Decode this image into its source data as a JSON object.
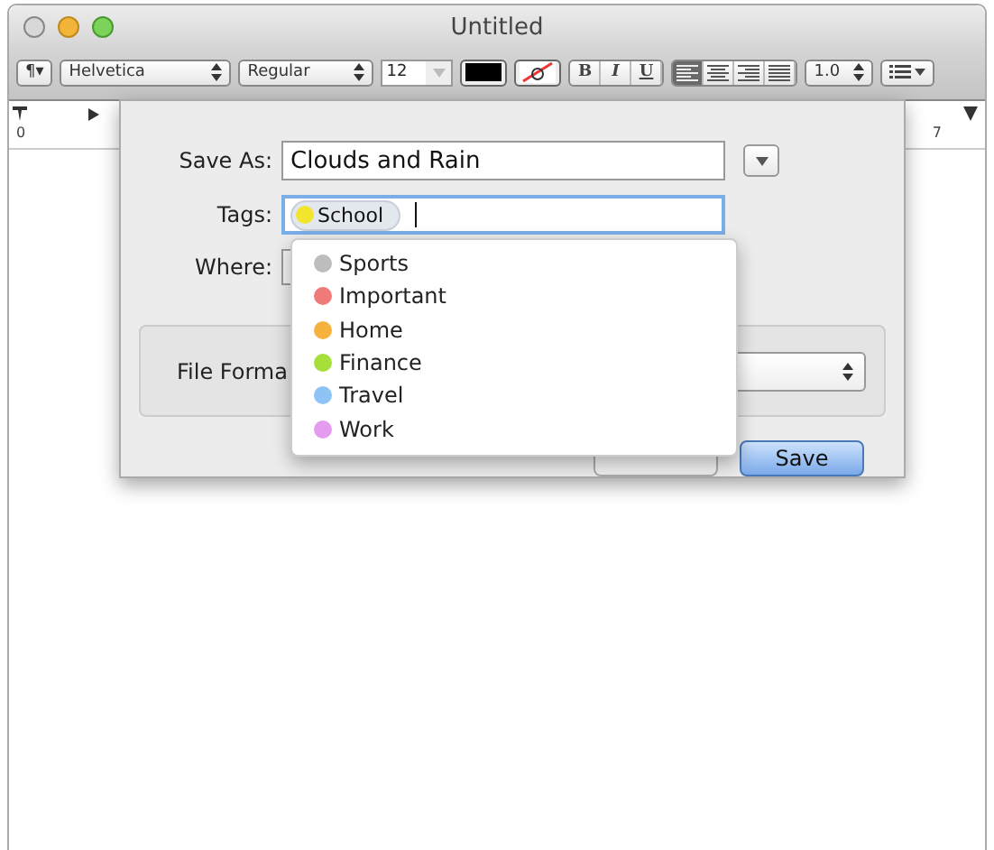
{
  "window": {
    "title": "Untitled"
  },
  "toolbar": {
    "paragraph": "¶▾",
    "font": "Helvetica",
    "style": "Regular",
    "size": "12",
    "font_styles": [
      "B",
      "I",
      "U"
    ],
    "alignment": [
      {
        "selected": true
      },
      {
        "selected": false
      },
      {
        "selected": false
      },
      {
        "selected": false
      }
    ],
    "spacing": "1.0"
  },
  "ruler": {
    "labels": [
      "0",
      "7"
    ]
  },
  "save_sheet": {
    "save_as_label": "Save As:",
    "save_as_value": "Clouds and Rain",
    "tags_label": "Tags:",
    "tags": [
      {
        "label": "School",
        "color": "#f2e52e"
      }
    ],
    "where_label": "Where:",
    "file_format_label": "File Forma",
    "save_button": "Save"
  },
  "tag_menu": [
    {
      "label": "Sports",
      "color": "#bdbdbd"
    },
    {
      "label": "Important",
      "color": "#ef7a7a"
    },
    {
      "label": "Home",
      "color": "#f7b23d"
    },
    {
      "label": "Finance",
      "color": "#a6de3a"
    },
    {
      "label": "Travel",
      "color": "#8dc3f5"
    },
    {
      "label": "Work",
      "color": "#e59bf0"
    }
  ]
}
